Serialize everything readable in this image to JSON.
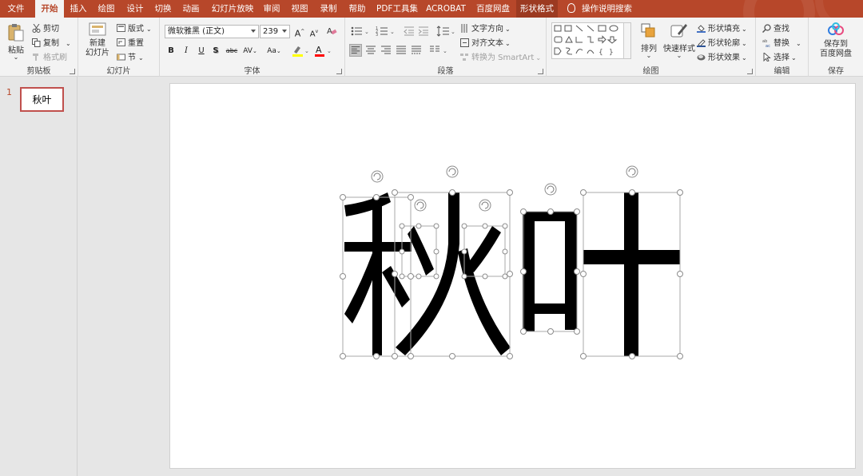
{
  "tabs": [
    {
      "label": "文件",
      "active": false
    },
    {
      "label": "开始",
      "active": true
    },
    {
      "label": "插入",
      "active": false
    },
    {
      "label": "绘图",
      "active": false
    },
    {
      "label": "设计",
      "active": false
    },
    {
      "label": "切换",
      "active": false
    },
    {
      "label": "动画",
      "active": false
    },
    {
      "label": "幻灯片放映",
      "active": false
    },
    {
      "label": "审阅",
      "active": false
    },
    {
      "label": "视图",
      "active": false
    },
    {
      "label": "录制",
      "active": false
    },
    {
      "label": "帮助",
      "active": false
    },
    {
      "label": "PDF工具集",
      "active": false
    },
    {
      "label": "ACROBAT",
      "active": false
    },
    {
      "label": "百度网盘",
      "active": false
    },
    {
      "label": "形状格式",
      "active": false
    }
  ],
  "help_search": "操作说明搜索",
  "clipboard": {
    "label": "剪贴板",
    "paste": "粘贴",
    "cut": "剪切",
    "copy": "复制",
    "format_painter": "格式刷"
  },
  "slides_group": {
    "label": "幻灯片",
    "new_slide_line1": "新建",
    "new_slide_line2": "幻灯片",
    "layout": "版式",
    "reset": "重置",
    "section": "节"
  },
  "font": {
    "label": "字体",
    "name": "微软雅黑 (正文)",
    "size": "239",
    "bold": "B",
    "italic": "I",
    "underline": "U",
    "shadow": "S",
    "strike": "abc",
    "spacing": "AV",
    "case": "Aa"
  },
  "paragraph": {
    "label": "段落",
    "text_direction": "文字方向",
    "align_text": "对齐文本",
    "smartart": "转换为 SmartArt"
  },
  "drawing": {
    "label": "绘图",
    "arrange": "排列",
    "quick_styles": "快速样式",
    "shape_fill": "形状填充",
    "shape_outline": "形状轮廓",
    "shape_effects": "形状效果"
  },
  "editing": {
    "label": "编辑",
    "find": "查找",
    "replace": "替换",
    "select": "选择"
  },
  "save": {
    "label": "保存",
    "save_line1": "保存到",
    "save_line2": "百度网盘"
  },
  "thumbnail": {
    "number": "1",
    "text": "秋叶"
  },
  "colors": {
    "accent": "#b7472a",
    "tabbar": "#b7472a",
    "ribbon": "#f3f3f3",
    "thumb_border": "#c0504d",
    "handle": "#808080",
    "glyph": "#000000"
  }
}
